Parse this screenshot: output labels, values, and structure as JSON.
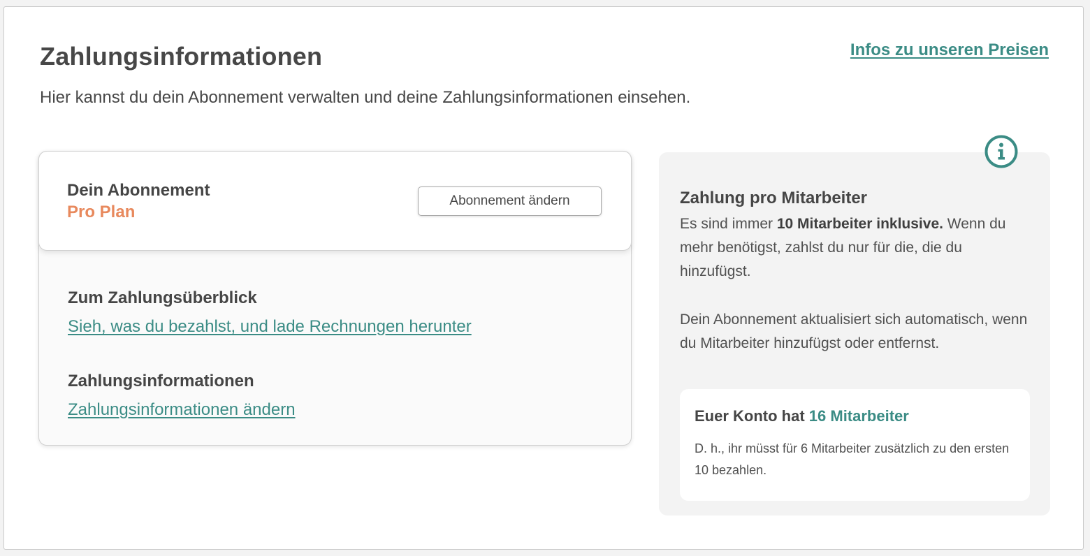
{
  "header": {
    "title": "Zahlungsinformationen",
    "pricing_link": "Infos zu unseren Preisen",
    "subtitle": "Hier kannst du dein Abonnement verwalten und deine Zahlungsinformationen einsehen."
  },
  "subscription": {
    "label": "Dein Abonnement",
    "plan": "Pro Plan",
    "change_button": "Abonnement ändern"
  },
  "payment_overview": {
    "heading": "Zum Zahlungsüberblick",
    "link": "Sieh, was du bezahlst, und lade Rechnungen herunter"
  },
  "payment_info": {
    "heading": "Zahlungsinformationen",
    "link": "Zahlungsinformationen ändern"
  },
  "info_panel": {
    "icon": "info-icon",
    "title": "Zahlung pro Mitarbeiter",
    "p1_pre": "Es sind immer ",
    "p1_bold": "10 Mitarbeiter inklusive.",
    "p1_post": " Wenn du mehr benötigst, zahlst du nur für die, die du hinzufügst.",
    "p2": "Dein Abonnement aktualisiert sich automatisch, wenn du Mitarbeiter hinzufügst oder entfernst.",
    "account": {
      "title_pre": "Euer Konto hat ",
      "title_count": "16 Mitarbeiter",
      "text": "D. h., ihr müsst für 6 Mitarbeiter zusätzlich zu den ersten 10 bezahlen."
    }
  },
  "colors": {
    "accent": "#3b8c85",
    "plan": "#e8895d",
    "text": "#474747",
    "panel_bg": "#f3f3f3"
  }
}
